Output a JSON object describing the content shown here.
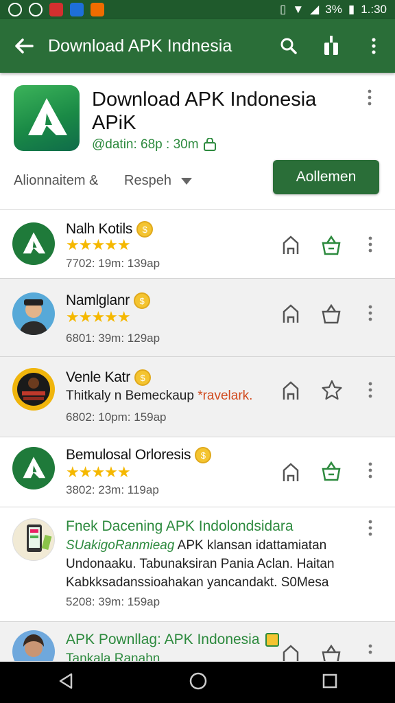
{
  "status_bar": {
    "battery": "3%",
    "time": "1.:30"
  },
  "app_bar": {
    "title": "Download APK Indnesia"
  },
  "header": {
    "title": "Download APK Indonesia APiK",
    "meta": "@datin: 68p : 30m",
    "filter_label": "Alionnaitem &",
    "sort_label": "Respeh",
    "primary_button": "Aollemen"
  },
  "items": [
    {
      "name": "Nalh Kotils",
      "stars": "★★★★★",
      "meta": "7702: 19m: 139ap"
    },
    {
      "name": "Namlglanr",
      "stars": "★★★★★",
      "meta": "6801: 39m: 129ap"
    },
    {
      "name": "Venle Katr",
      "desc": "Thitkaly n Bemeckaup",
      "desc_accent": "*ravelark.",
      "meta": "6802: 10pm: 159ap"
    },
    {
      "name": "Bemulosal Orloresis",
      "stars": "★★★★★",
      "meta": "3802: 23m: 119ap"
    },
    {
      "title": "Fnek Dacening APK Indolondsidara",
      "sub_italic": "SUakigoRanmieag",
      "sub_rest": " APK klansan idattamiatan Undonaaku. Tabunaksiran Pania Aclan. Haitan Kabkksadanssioahakan yancandakt. S0Mesa",
      "meta": "5208: 39m: 159ap"
    },
    {
      "title": "APK Pownllag: APK Indonesia",
      "sub": "Tankala Ranahn"
    }
  ],
  "colors": {
    "primary": "#2a6e38",
    "status": "#1f5a2c",
    "accent_text": "#2d8a3e",
    "star": "#f5b800"
  }
}
